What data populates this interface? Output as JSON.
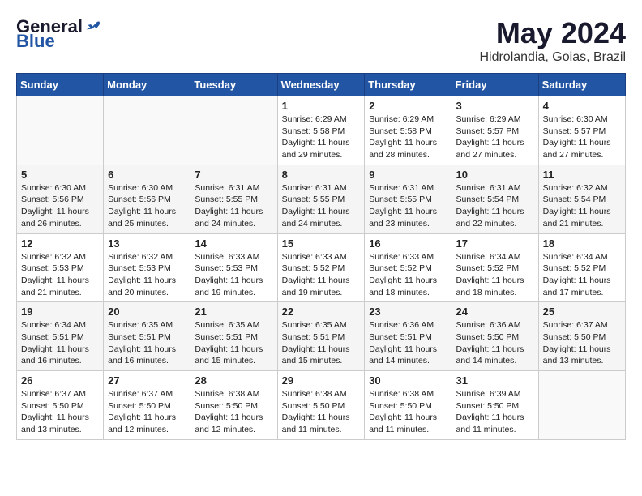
{
  "header": {
    "logo_general": "General",
    "logo_blue": "Blue",
    "month_title": "May 2024",
    "subtitle": "Hidrolandia, Goias, Brazil"
  },
  "weekdays": [
    "Sunday",
    "Monday",
    "Tuesday",
    "Wednesday",
    "Thursday",
    "Friday",
    "Saturday"
  ],
  "weeks": [
    [
      {
        "day": "",
        "info": ""
      },
      {
        "day": "",
        "info": ""
      },
      {
        "day": "",
        "info": ""
      },
      {
        "day": "1",
        "info": "Sunrise: 6:29 AM\nSunset: 5:58 PM\nDaylight: 11 hours and 29 minutes."
      },
      {
        "day": "2",
        "info": "Sunrise: 6:29 AM\nSunset: 5:58 PM\nDaylight: 11 hours and 28 minutes."
      },
      {
        "day": "3",
        "info": "Sunrise: 6:29 AM\nSunset: 5:57 PM\nDaylight: 11 hours and 27 minutes."
      },
      {
        "day": "4",
        "info": "Sunrise: 6:30 AM\nSunset: 5:57 PM\nDaylight: 11 hours and 27 minutes."
      }
    ],
    [
      {
        "day": "5",
        "info": "Sunrise: 6:30 AM\nSunset: 5:56 PM\nDaylight: 11 hours and 26 minutes."
      },
      {
        "day": "6",
        "info": "Sunrise: 6:30 AM\nSunset: 5:56 PM\nDaylight: 11 hours and 25 minutes."
      },
      {
        "day": "7",
        "info": "Sunrise: 6:31 AM\nSunset: 5:55 PM\nDaylight: 11 hours and 24 minutes."
      },
      {
        "day": "8",
        "info": "Sunrise: 6:31 AM\nSunset: 5:55 PM\nDaylight: 11 hours and 24 minutes."
      },
      {
        "day": "9",
        "info": "Sunrise: 6:31 AM\nSunset: 5:55 PM\nDaylight: 11 hours and 23 minutes."
      },
      {
        "day": "10",
        "info": "Sunrise: 6:31 AM\nSunset: 5:54 PM\nDaylight: 11 hours and 22 minutes."
      },
      {
        "day": "11",
        "info": "Sunrise: 6:32 AM\nSunset: 5:54 PM\nDaylight: 11 hours and 21 minutes."
      }
    ],
    [
      {
        "day": "12",
        "info": "Sunrise: 6:32 AM\nSunset: 5:53 PM\nDaylight: 11 hours and 21 minutes."
      },
      {
        "day": "13",
        "info": "Sunrise: 6:32 AM\nSunset: 5:53 PM\nDaylight: 11 hours and 20 minutes."
      },
      {
        "day": "14",
        "info": "Sunrise: 6:33 AM\nSunset: 5:53 PM\nDaylight: 11 hours and 19 minutes."
      },
      {
        "day": "15",
        "info": "Sunrise: 6:33 AM\nSunset: 5:52 PM\nDaylight: 11 hours and 19 minutes."
      },
      {
        "day": "16",
        "info": "Sunrise: 6:33 AM\nSunset: 5:52 PM\nDaylight: 11 hours and 18 minutes."
      },
      {
        "day": "17",
        "info": "Sunrise: 6:34 AM\nSunset: 5:52 PM\nDaylight: 11 hours and 18 minutes."
      },
      {
        "day": "18",
        "info": "Sunrise: 6:34 AM\nSunset: 5:52 PM\nDaylight: 11 hours and 17 minutes."
      }
    ],
    [
      {
        "day": "19",
        "info": "Sunrise: 6:34 AM\nSunset: 5:51 PM\nDaylight: 11 hours and 16 minutes."
      },
      {
        "day": "20",
        "info": "Sunrise: 6:35 AM\nSunset: 5:51 PM\nDaylight: 11 hours and 16 minutes."
      },
      {
        "day": "21",
        "info": "Sunrise: 6:35 AM\nSunset: 5:51 PM\nDaylight: 11 hours and 15 minutes."
      },
      {
        "day": "22",
        "info": "Sunrise: 6:35 AM\nSunset: 5:51 PM\nDaylight: 11 hours and 15 minutes."
      },
      {
        "day": "23",
        "info": "Sunrise: 6:36 AM\nSunset: 5:51 PM\nDaylight: 11 hours and 14 minutes."
      },
      {
        "day": "24",
        "info": "Sunrise: 6:36 AM\nSunset: 5:50 PM\nDaylight: 11 hours and 14 minutes."
      },
      {
        "day": "25",
        "info": "Sunrise: 6:37 AM\nSunset: 5:50 PM\nDaylight: 11 hours and 13 minutes."
      }
    ],
    [
      {
        "day": "26",
        "info": "Sunrise: 6:37 AM\nSunset: 5:50 PM\nDaylight: 11 hours and 13 minutes."
      },
      {
        "day": "27",
        "info": "Sunrise: 6:37 AM\nSunset: 5:50 PM\nDaylight: 11 hours and 12 minutes."
      },
      {
        "day": "28",
        "info": "Sunrise: 6:38 AM\nSunset: 5:50 PM\nDaylight: 11 hours and 12 minutes."
      },
      {
        "day": "29",
        "info": "Sunrise: 6:38 AM\nSunset: 5:50 PM\nDaylight: 11 hours and 11 minutes."
      },
      {
        "day": "30",
        "info": "Sunrise: 6:38 AM\nSunset: 5:50 PM\nDaylight: 11 hours and 11 minutes."
      },
      {
        "day": "31",
        "info": "Sunrise: 6:39 AM\nSunset: 5:50 PM\nDaylight: 11 hours and 11 minutes."
      },
      {
        "day": "",
        "info": ""
      }
    ]
  ]
}
